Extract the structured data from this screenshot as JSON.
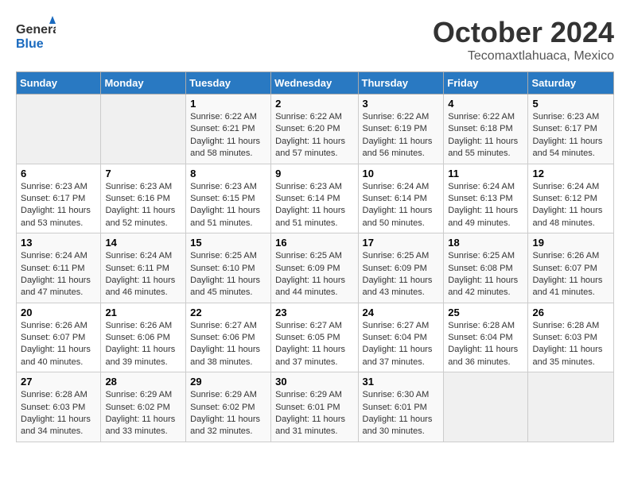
{
  "header": {
    "logo_general": "General",
    "logo_blue": "Blue",
    "month": "October 2024",
    "location": "Tecomaxtlahuaca, Mexico"
  },
  "days_of_week": [
    "Sunday",
    "Monday",
    "Tuesday",
    "Wednesday",
    "Thursday",
    "Friday",
    "Saturday"
  ],
  "weeks": [
    [
      {
        "day": "",
        "sunrise": "",
        "sunset": "",
        "daylight": ""
      },
      {
        "day": "",
        "sunrise": "",
        "sunset": "",
        "daylight": ""
      },
      {
        "day": "1",
        "sunrise": "Sunrise: 6:22 AM",
        "sunset": "Sunset: 6:21 PM",
        "daylight": "Daylight: 11 hours and 58 minutes."
      },
      {
        "day": "2",
        "sunrise": "Sunrise: 6:22 AM",
        "sunset": "Sunset: 6:20 PM",
        "daylight": "Daylight: 11 hours and 57 minutes."
      },
      {
        "day": "3",
        "sunrise": "Sunrise: 6:22 AM",
        "sunset": "Sunset: 6:19 PM",
        "daylight": "Daylight: 11 hours and 56 minutes."
      },
      {
        "day": "4",
        "sunrise": "Sunrise: 6:22 AM",
        "sunset": "Sunset: 6:18 PM",
        "daylight": "Daylight: 11 hours and 55 minutes."
      },
      {
        "day": "5",
        "sunrise": "Sunrise: 6:23 AM",
        "sunset": "Sunset: 6:17 PM",
        "daylight": "Daylight: 11 hours and 54 minutes."
      }
    ],
    [
      {
        "day": "6",
        "sunrise": "Sunrise: 6:23 AM",
        "sunset": "Sunset: 6:17 PM",
        "daylight": "Daylight: 11 hours and 53 minutes."
      },
      {
        "day": "7",
        "sunrise": "Sunrise: 6:23 AM",
        "sunset": "Sunset: 6:16 PM",
        "daylight": "Daylight: 11 hours and 52 minutes."
      },
      {
        "day": "8",
        "sunrise": "Sunrise: 6:23 AM",
        "sunset": "Sunset: 6:15 PM",
        "daylight": "Daylight: 11 hours and 51 minutes."
      },
      {
        "day": "9",
        "sunrise": "Sunrise: 6:23 AM",
        "sunset": "Sunset: 6:14 PM",
        "daylight": "Daylight: 11 hours and 51 minutes."
      },
      {
        "day": "10",
        "sunrise": "Sunrise: 6:24 AM",
        "sunset": "Sunset: 6:14 PM",
        "daylight": "Daylight: 11 hours and 50 minutes."
      },
      {
        "day": "11",
        "sunrise": "Sunrise: 6:24 AM",
        "sunset": "Sunset: 6:13 PM",
        "daylight": "Daylight: 11 hours and 49 minutes."
      },
      {
        "day": "12",
        "sunrise": "Sunrise: 6:24 AM",
        "sunset": "Sunset: 6:12 PM",
        "daylight": "Daylight: 11 hours and 48 minutes."
      }
    ],
    [
      {
        "day": "13",
        "sunrise": "Sunrise: 6:24 AM",
        "sunset": "Sunset: 6:11 PM",
        "daylight": "Daylight: 11 hours and 47 minutes."
      },
      {
        "day": "14",
        "sunrise": "Sunrise: 6:24 AM",
        "sunset": "Sunset: 6:11 PM",
        "daylight": "Daylight: 11 hours and 46 minutes."
      },
      {
        "day": "15",
        "sunrise": "Sunrise: 6:25 AM",
        "sunset": "Sunset: 6:10 PM",
        "daylight": "Daylight: 11 hours and 45 minutes."
      },
      {
        "day": "16",
        "sunrise": "Sunrise: 6:25 AM",
        "sunset": "Sunset: 6:09 PM",
        "daylight": "Daylight: 11 hours and 44 minutes."
      },
      {
        "day": "17",
        "sunrise": "Sunrise: 6:25 AM",
        "sunset": "Sunset: 6:09 PM",
        "daylight": "Daylight: 11 hours and 43 minutes."
      },
      {
        "day": "18",
        "sunrise": "Sunrise: 6:25 AM",
        "sunset": "Sunset: 6:08 PM",
        "daylight": "Daylight: 11 hours and 42 minutes."
      },
      {
        "day": "19",
        "sunrise": "Sunrise: 6:26 AM",
        "sunset": "Sunset: 6:07 PM",
        "daylight": "Daylight: 11 hours and 41 minutes."
      }
    ],
    [
      {
        "day": "20",
        "sunrise": "Sunrise: 6:26 AM",
        "sunset": "Sunset: 6:07 PM",
        "daylight": "Daylight: 11 hours and 40 minutes."
      },
      {
        "day": "21",
        "sunrise": "Sunrise: 6:26 AM",
        "sunset": "Sunset: 6:06 PM",
        "daylight": "Daylight: 11 hours and 39 minutes."
      },
      {
        "day": "22",
        "sunrise": "Sunrise: 6:27 AM",
        "sunset": "Sunset: 6:06 PM",
        "daylight": "Daylight: 11 hours and 38 minutes."
      },
      {
        "day": "23",
        "sunrise": "Sunrise: 6:27 AM",
        "sunset": "Sunset: 6:05 PM",
        "daylight": "Daylight: 11 hours and 37 minutes."
      },
      {
        "day": "24",
        "sunrise": "Sunrise: 6:27 AM",
        "sunset": "Sunset: 6:04 PM",
        "daylight": "Daylight: 11 hours and 37 minutes."
      },
      {
        "day": "25",
        "sunrise": "Sunrise: 6:28 AM",
        "sunset": "Sunset: 6:04 PM",
        "daylight": "Daylight: 11 hours and 36 minutes."
      },
      {
        "day": "26",
        "sunrise": "Sunrise: 6:28 AM",
        "sunset": "Sunset: 6:03 PM",
        "daylight": "Daylight: 11 hours and 35 minutes."
      }
    ],
    [
      {
        "day": "27",
        "sunrise": "Sunrise: 6:28 AM",
        "sunset": "Sunset: 6:03 PM",
        "daylight": "Daylight: 11 hours and 34 minutes."
      },
      {
        "day": "28",
        "sunrise": "Sunrise: 6:29 AM",
        "sunset": "Sunset: 6:02 PM",
        "daylight": "Daylight: 11 hours and 33 minutes."
      },
      {
        "day": "29",
        "sunrise": "Sunrise: 6:29 AM",
        "sunset": "Sunset: 6:02 PM",
        "daylight": "Daylight: 11 hours and 32 minutes."
      },
      {
        "day": "30",
        "sunrise": "Sunrise: 6:29 AM",
        "sunset": "Sunset: 6:01 PM",
        "daylight": "Daylight: 11 hours and 31 minutes."
      },
      {
        "day": "31",
        "sunrise": "Sunrise: 6:30 AM",
        "sunset": "Sunset: 6:01 PM",
        "daylight": "Daylight: 11 hours and 30 minutes."
      },
      {
        "day": "",
        "sunrise": "",
        "sunset": "",
        "daylight": ""
      },
      {
        "day": "",
        "sunrise": "",
        "sunset": "",
        "daylight": ""
      }
    ]
  ]
}
